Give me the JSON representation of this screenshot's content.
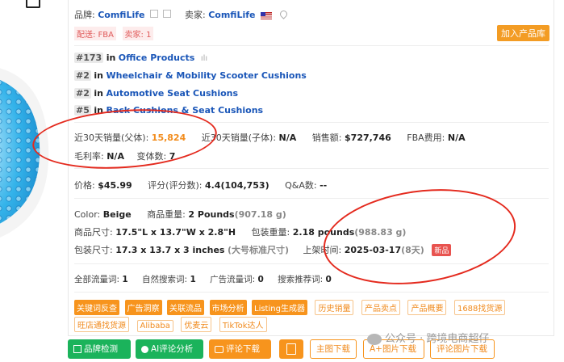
{
  "brand": {
    "label": "品牌:",
    "value": "ComfiLife"
  },
  "seller": {
    "label": "卖家:",
    "value": "ComfiLife"
  },
  "tags": [
    "配送: FBA",
    "卖家: 1"
  ],
  "add_to_library": "加入产品库",
  "ranks": [
    {
      "num": "#173",
      "in": "in",
      "category": "Office Products"
    },
    {
      "num": "#2",
      "in": "in",
      "category": "Wheelchair & Mobility Scooter Cushions"
    },
    {
      "num": "#2",
      "in": "in",
      "category": "Automotive Seat Cushions"
    },
    {
      "num": "#5",
      "in": "in",
      "category": "Back Cushions & Seat Cushions"
    }
  ],
  "sales": {
    "parent_label": "近30天销量(父体):",
    "parent_value": "15,824",
    "child_label": "近30天销量(子体):",
    "child_value": "N/A",
    "revenue_label": "销售额:",
    "revenue_value": "$727,746",
    "fba_label": "FBA费用:",
    "fba_value": "N/A",
    "margin_label": "毛利率:",
    "margin_value": "N/A",
    "variants_label": "变体数:",
    "variants_value": "7"
  },
  "price": {
    "label": "价格:",
    "value": "$45.99",
    "rating_label": "评分(评分数):",
    "rating_value": "4.4(104,753)",
    "qa_label": "Q&A数:",
    "qa_value": "--"
  },
  "specs": {
    "color_label": "Color:",
    "color_value": "Beige",
    "weight_label": "商品重量:",
    "weight_value": "2 Pounds",
    "weight_alt": "(907.18 g)",
    "size_label": "商品尺寸:",
    "size_value": "17.5\"L x 13.7\"W x 2.8\"H",
    "pkg_weight_label": "包装重量:",
    "pkg_weight_value": "2.18 pounds",
    "pkg_weight_alt": "(988.83 g)",
    "pkg_size_label": "包装尺寸:",
    "pkg_size_value": "17.3 x 13.7 x 3 inches",
    "pkg_size_alt": "(大号标准尺寸)",
    "launch_label": "上架时间:",
    "launch_value": "2025-03-17",
    "launch_alt": "(8天)",
    "new_tag": "新品"
  },
  "traffic": {
    "all_label": "全部流量词:",
    "all_value": "1",
    "natural_label": "自然搜索词:",
    "natural_value": "1",
    "ad_label": "广告流量词:",
    "ad_value": "0",
    "rec_label": "搜索推荐词:",
    "rec_value": "0"
  },
  "chips_solid": [
    "关键词反查",
    "广告洞察",
    "关联流品",
    "市场分析",
    "Listing生成器"
  ],
  "chips_outline_row1": [
    "历史销量",
    "产品卖点",
    "产品概要",
    "1688找货源"
  ],
  "chips_outline_row2": [
    "旺店通找货源",
    "Alibaba",
    "优麦云",
    "TikTok达人"
  ],
  "buttons": {
    "detect": "品牌检测",
    "ai_review": "AI评论分析",
    "review_download": "评论下载",
    "main_image": "主图下载",
    "a_plus_image": "A+图片下载",
    "review_image": "评论图片下载"
  },
  "watermark": "公众号 · 跨境电商超仔",
  "colors": {
    "accent_orange": "#f7941d",
    "link_blue": "#1a56b8",
    "green": "#1bb35b",
    "annotation_red": "#e42a1e"
  }
}
